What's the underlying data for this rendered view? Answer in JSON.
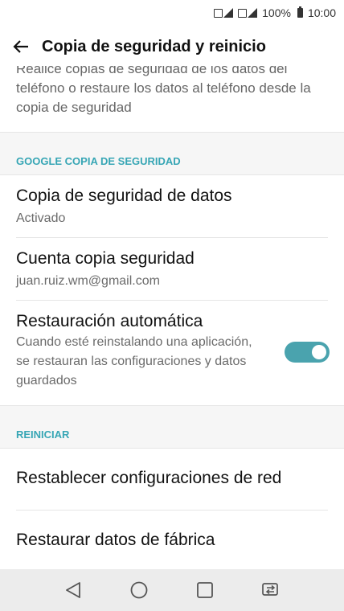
{
  "status_bar": {
    "battery": "100%",
    "time": "10:00"
  },
  "app_bar": {
    "title": "Copia de seguridad y reinicio"
  },
  "description": "Realice copias de seguridad de los datos del teléfono o restaure los datos al teléfono desde la copia de seguridad",
  "sections": [
    {
      "header": "GOOGLE COPIA DE SEGURIDAD",
      "items": [
        {
          "title": "Copia de seguridad de datos",
          "subtitle": "Activado"
        },
        {
          "title": "Cuenta copia seguridad",
          "subtitle": "juan.ruiz.wm@gmail.com"
        },
        {
          "title": "Restauración automática",
          "subtitle": "Cuando esté reinstalando una aplicación, se restauran las configuraciones y datos guardados",
          "toggle_on": true
        }
      ]
    },
    {
      "header": "REINICIAR",
      "items": [
        {
          "title": "Restablecer configuraciones de red"
        },
        {
          "title": "Restaurar datos de fábrica"
        }
      ]
    }
  ],
  "colors": {
    "accent": "#37a6b5",
    "toggle": "#4aa3ae"
  },
  "nav_icons": [
    "back-icon",
    "home-icon",
    "recents-icon",
    "dual-window-icon"
  ]
}
